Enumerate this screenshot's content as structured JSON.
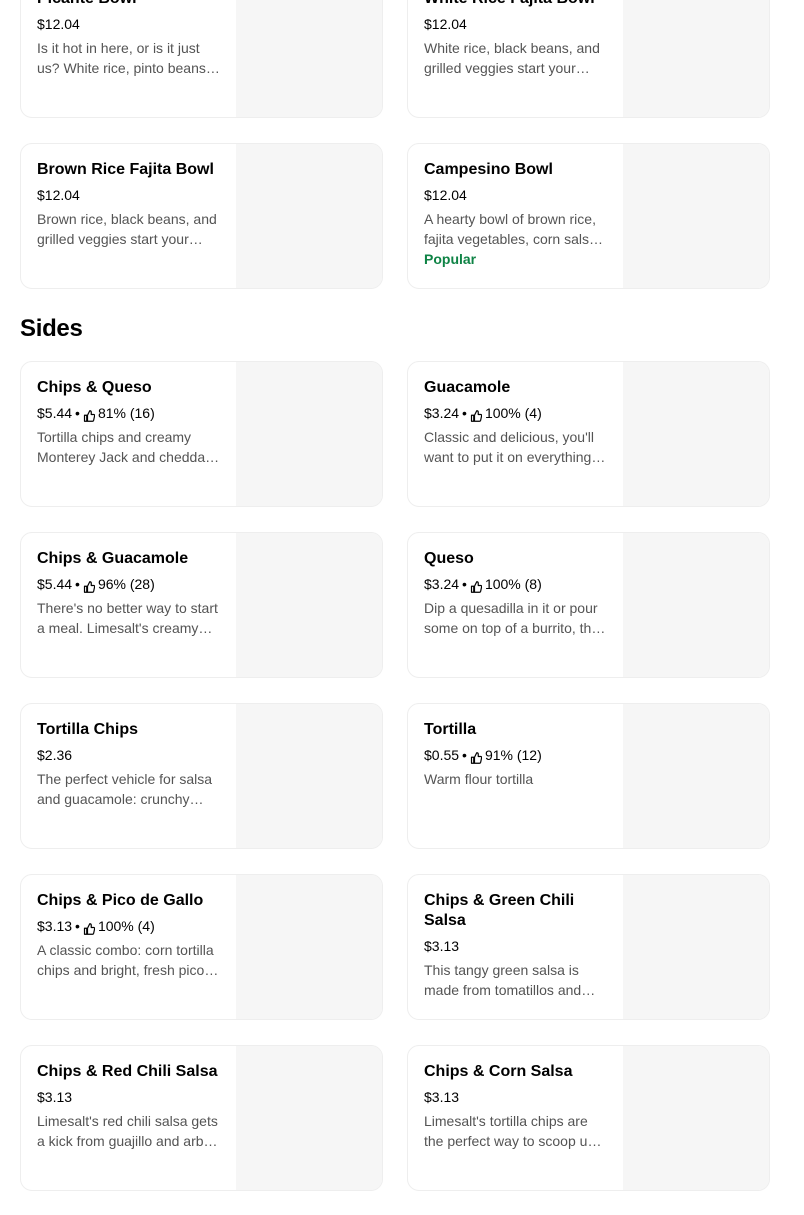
{
  "top_items": [
    {
      "title": "Picante Bowl",
      "price": "$12.04",
      "rating": "",
      "description": "Is it hot in here, or is it just us? White rice, pinto beans, grilled veggies, chicken and spicy salsa.",
      "badge": ""
    },
    {
      "title": "White Rice Fajita Bowl",
      "price": "$12.04",
      "rating": "",
      "description": "White rice, black beans, and grilled veggies start your bowl off right.",
      "badge": ""
    },
    {
      "title": "Brown Rice Fajita Bowl",
      "price": "$12.04",
      "rating": "",
      "description": "Brown rice, black beans, and grilled veggies start your bowl off right.",
      "badge": ""
    },
    {
      "title": "Campesino Bowl",
      "price": "$12.04",
      "rating": "",
      "description": "A hearty bowl of brown rice, fajita vegetables, corn salsa and more.",
      "badge": "Popular"
    }
  ],
  "sides_section": {
    "title": "Sides"
  },
  "sides": [
    {
      "title": "Chips & Queso",
      "price": "$5.44",
      "rating": "81% (16)",
      "description": "Tortilla chips and creamy Monterey Jack and cheddar cheese dip.",
      "badge": ""
    },
    {
      "title": "Guacamole",
      "price": "$3.24",
      "rating": "100% (4)",
      "description": "Classic and delicious, you'll want to put it on everything you order.",
      "badge": ""
    },
    {
      "title": "Chips & Guacamole",
      "price": "$5.44",
      "rating": "96% (28)",
      "description": "There's no better way to start a meal. Limesalt's creamy guacamole and chips.",
      "badge": ""
    },
    {
      "title": "Queso",
      "price": "$3.24",
      "rating": "100% (8)",
      "description": "Dip a quesadilla in it or pour some on top of a burrito, this queso is great.",
      "badge": ""
    },
    {
      "title": "Tortilla Chips",
      "price": "$2.36",
      "rating": "",
      "description": "The perfect vehicle for salsa and guacamole: crunchy tortilla chips.",
      "badge": ""
    },
    {
      "title": "Tortilla",
      "price": "$0.55",
      "rating": "91% (12)",
      "description": "Warm flour tortilla",
      "badge": ""
    },
    {
      "title": "Chips & Pico de Gallo",
      "price": "$3.13",
      "rating": "100% (4)",
      "description": "A classic combo: corn tortilla chips and bright, fresh pico de gallo.",
      "badge": ""
    },
    {
      "title": "Chips & Green Chili Salsa",
      "price": "$3.13",
      "rating": "",
      "description": "This tangy green salsa is made from tomatillos and green chilies.",
      "badge": ""
    },
    {
      "title": "Chips & Red Chili Salsa",
      "price": "$3.13",
      "rating": "",
      "description": "Limesalt's red chili salsa gets a kick from guajillo and arbol chilies.",
      "badge": ""
    },
    {
      "title": "Chips & Corn Salsa",
      "price": "$3.13",
      "rating": "",
      "description": "Limesalt's tortilla chips are the perfect way to scoop up corn salsa.",
      "badge": ""
    }
  ],
  "icons": {
    "rating": "thumbs-up-icon"
  },
  "colors": {
    "popular_badge": "#0e8345",
    "card_border": "#eeeeee",
    "image_placeholder": "#f6f6f6",
    "description_text": "#545454"
  }
}
